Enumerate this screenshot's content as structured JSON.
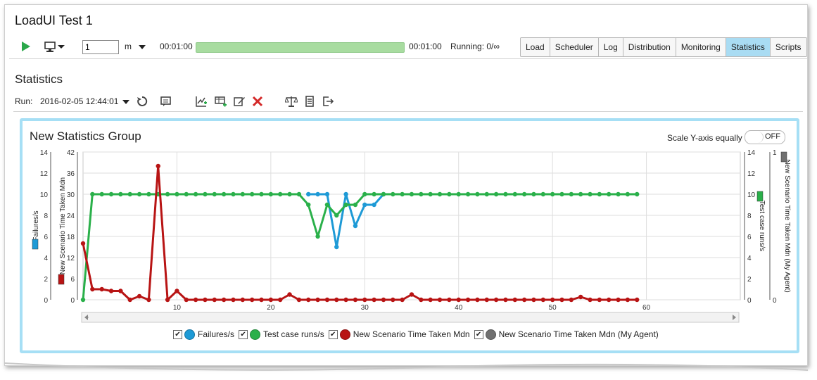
{
  "window": {
    "title": "LoadUI Test 1"
  },
  "toolbar": {
    "play_icon": "play-icon",
    "monitor_icon": "monitor-icon",
    "limit_value": "1",
    "limit_unit": "m",
    "elapsed": "00:01:00",
    "total": "00:01:00",
    "progress": 1.0,
    "running": "Running: 0/∞",
    "progress_color": "#a8dca0"
  },
  "tabs": [
    {
      "label": "Load",
      "active": false
    },
    {
      "label": "Scheduler",
      "active": false
    },
    {
      "label": "Log",
      "active": false
    },
    {
      "label": "Distribution",
      "active": false
    },
    {
      "label": "Monitoring",
      "active": false
    },
    {
      "label": "Statistics",
      "active": true
    },
    {
      "label": "Scripts",
      "active": false
    }
  ],
  "statistics": {
    "heading": "Statistics",
    "run_label": "Run:",
    "run_value": "2016-02-05 12:44:01"
  },
  "group": {
    "title": "New Statistics Group",
    "scale_label": "Scale Y-axis equally",
    "scale_toggle": "OFF"
  },
  "chart_data": {
    "type": "line",
    "xlim": [
      0,
      70
    ],
    "x_ticks": [
      10,
      20,
      30,
      40,
      50,
      60
    ],
    "grid": true,
    "axes": {
      "left_outer": {
        "label": "Failures/s",
        "ticks": [
          0,
          2,
          4,
          6,
          8,
          10,
          12,
          14
        ],
        "range": [
          0,
          14
        ],
        "color": "#1e9ad6"
      },
      "left_inner": {
        "label": "New Scenario Time Taken Mdn",
        "ticks": [
          0,
          6,
          12,
          18,
          24,
          30,
          36,
          42
        ],
        "range": [
          0,
          42
        ],
        "color": "#b81414"
      },
      "right_inner": {
        "label": "Test case runs/s",
        "ticks": [
          0,
          2,
          4,
          6,
          8,
          10,
          12,
          14
        ],
        "range": [
          0,
          14
        ],
        "color": "#2ab04a"
      },
      "right_outer": {
        "label": "New Scenario Time Taken Mdn (My Agent)",
        "ticks": [
          0,
          1
        ],
        "range": [
          0,
          1
        ],
        "color": "#707070"
      }
    },
    "series": [
      {
        "name": "Failures/s",
        "color": "#1e9ad6",
        "axis": "left_outer",
        "points": [
          [
            24,
            10
          ],
          [
            25,
            10
          ],
          [
            26,
            10
          ],
          [
            27,
            5
          ],
          [
            28,
            10
          ],
          [
            29,
            7
          ],
          [
            30,
            9
          ],
          [
            31,
            9
          ],
          [
            32,
            10
          ]
        ]
      },
      {
        "name": "Test case runs/s",
        "color": "#2ab04a",
        "axis": "right_inner",
        "points": [
          [
            0,
            0
          ],
          [
            1,
            10
          ],
          [
            2,
            10
          ],
          [
            3,
            10
          ],
          [
            4,
            10
          ],
          [
            5,
            10
          ],
          [
            6,
            10
          ],
          [
            7,
            10
          ],
          [
            8,
            10
          ],
          [
            9,
            10
          ],
          [
            10,
            10
          ],
          [
            11,
            10
          ],
          [
            12,
            10
          ],
          [
            13,
            10
          ],
          [
            14,
            10
          ],
          [
            15,
            10
          ],
          [
            16,
            10
          ],
          [
            17,
            10
          ],
          [
            18,
            10
          ],
          [
            19,
            10
          ],
          [
            20,
            10
          ],
          [
            21,
            10
          ],
          [
            22,
            10
          ],
          [
            23,
            10
          ],
          [
            24,
            9
          ],
          [
            25,
            6
          ],
          [
            26,
            9
          ],
          [
            27,
            8
          ],
          [
            28,
            9
          ],
          [
            29,
            9
          ],
          [
            30,
            10
          ],
          [
            31,
            10
          ],
          [
            32,
            10
          ],
          [
            33,
            10
          ],
          [
            34,
            10
          ],
          [
            35,
            10
          ],
          [
            36,
            10
          ],
          [
            37,
            10
          ],
          [
            38,
            10
          ],
          [
            39,
            10
          ],
          [
            40,
            10
          ],
          [
            41,
            10
          ],
          [
            42,
            10
          ],
          [
            43,
            10
          ],
          [
            44,
            10
          ],
          [
            45,
            10
          ],
          [
            46,
            10
          ],
          [
            47,
            10
          ],
          [
            48,
            10
          ],
          [
            49,
            10
          ],
          [
            50,
            10
          ],
          [
            51,
            10
          ],
          [
            52,
            10
          ],
          [
            53,
            10
          ],
          [
            54,
            10
          ],
          [
            55,
            10
          ],
          [
            56,
            10
          ],
          [
            57,
            10
          ],
          [
            58,
            10
          ],
          [
            59,
            10
          ]
        ]
      },
      {
        "name": "New Scenario Time Taken Mdn",
        "color": "#b81414",
        "axis": "left_inner",
        "points": [
          [
            0,
            16
          ],
          [
            1,
            3
          ],
          [
            2,
            3
          ],
          [
            3,
            2.5
          ],
          [
            4,
            2.5
          ],
          [
            5,
            0
          ],
          [
            6,
            1
          ],
          [
            7,
            0
          ],
          [
            8,
            38
          ],
          [
            9,
            0
          ],
          [
            10,
            2.5
          ],
          [
            11,
            0
          ],
          [
            12,
            0
          ],
          [
            13,
            0
          ],
          [
            14,
            0
          ],
          [
            15,
            0
          ],
          [
            16,
            0
          ],
          [
            17,
            0
          ],
          [
            18,
            0
          ],
          [
            19,
            0
          ],
          [
            20,
            0
          ],
          [
            21,
            0
          ],
          [
            22,
            1.5
          ],
          [
            23,
            0
          ],
          [
            24,
            0
          ],
          [
            25,
            0
          ],
          [
            26,
            0
          ],
          [
            27,
            0
          ],
          [
            28,
            0
          ],
          [
            29,
            0
          ],
          [
            30,
            0
          ],
          [
            31,
            0
          ],
          [
            32,
            0
          ],
          [
            33,
            0
          ],
          [
            34,
            0
          ],
          [
            35,
            1.5
          ],
          [
            36,
            0
          ],
          [
            37,
            0
          ],
          [
            38,
            0
          ],
          [
            39,
            0
          ],
          [
            40,
            0
          ],
          [
            41,
            0
          ],
          [
            42,
            0
          ],
          [
            43,
            0
          ],
          [
            44,
            0
          ],
          [
            45,
            0
          ],
          [
            46,
            0
          ],
          [
            47,
            0
          ],
          [
            48,
            0
          ],
          [
            49,
            0
          ],
          [
            50,
            0
          ],
          [
            51,
            0
          ],
          [
            52,
            0
          ],
          [
            53,
            0.8
          ],
          [
            54,
            0
          ],
          [
            55,
            0
          ],
          [
            56,
            0
          ],
          [
            57,
            0
          ],
          [
            58,
            0
          ],
          [
            59,
            0
          ]
        ]
      },
      {
        "name": "New Scenario Time Taken Mdn (My Agent)",
        "color": "#707070",
        "axis": "right_outer",
        "points": []
      }
    ]
  },
  "legend": [
    {
      "label": "Failures/s",
      "color": "#1e9ad6",
      "checked": true
    },
    {
      "label": "Test case runs/s",
      "color": "#2ab04a",
      "checked": true
    },
    {
      "label": "New Scenario Time Taken Mdn",
      "color": "#b81414",
      "checked": true
    },
    {
      "label": "New Scenario Time Taken Mdn (My Agent)",
      "color": "#707070",
      "checked": true
    }
  ]
}
